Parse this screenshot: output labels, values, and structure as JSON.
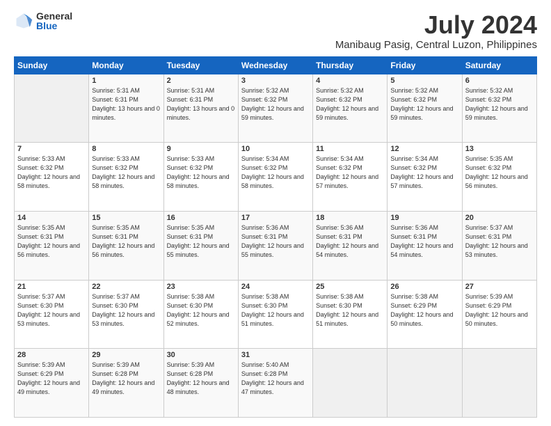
{
  "logo": {
    "general": "General",
    "blue": "Blue"
  },
  "title": "July 2024",
  "subtitle": "Manibaug Pasig, Central Luzon, Philippines",
  "days_header": [
    "Sunday",
    "Monday",
    "Tuesday",
    "Wednesday",
    "Thursday",
    "Friday",
    "Saturday"
  ],
  "weeks": [
    [
      {
        "day": "",
        "sunrise": "",
        "sunset": "",
        "daylight": ""
      },
      {
        "day": "1",
        "sunrise": "Sunrise: 5:31 AM",
        "sunset": "Sunset: 6:31 PM",
        "daylight": "Daylight: 13 hours and 0 minutes."
      },
      {
        "day": "2",
        "sunrise": "Sunrise: 5:31 AM",
        "sunset": "Sunset: 6:31 PM",
        "daylight": "Daylight: 13 hours and 0 minutes."
      },
      {
        "day": "3",
        "sunrise": "Sunrise: 5:32 AM",
        "sunset": "Sunset: 6:32 PM",
        "daylight": "Daylight: 12 hours and 59 minutes."
      },
      {
        "day": "4",
        "sunrise": "Sunrise: 5:32 AM",
        "sunset": "Sunset: 6:32 PM",
        "daylight": "Daylight: 12 hours and 59 minutes."
      },
      {
        "day": "5",
        "sunrise": "Sunrise: 5:32 AM",
        "sunset": "Sunset: 6:32 PM",
        "daylight": "Daylight: 12 hours and 59 minutes."
      },
      {
        "day": "6",
        "sunrise": "Sunrise: 5:32 AM",
        "sunset": "Sunset: 6:32 PM",
        "daylight": "Daylight: 12 hours and 59 minutes."
      }
    ],
    [
      {
        "day": "7",
        "sunrise": "Sunrise: 5:33 AM",
        "sunset": "Sunset: 6:32 PM",
        "daylight": "Daylight: 12 hours and 58 minutes."
      },
      {
        "day": "8",
        "sunrise": "Sunrise: 5:33 AM",
        "sunset": "Sunset: 6:32 PM",
        "daylight": "Daylight: 12 hours and 58 minutes."
      },
      {
        "day": "9",
        "sunrise": "Sunrise: 5:33 AM",
        "sunset": "Sunset: 6:32 PM",
        "daylight": "Daylight: 12 hours and 58 minutes."
      },
      {
        "day": "10",
        "sunrise": "Sunrise: 5:34 AM",
        "sunset": "Sunset: 6:32 PM",
        "daylight": "Daylight: 12 hours and 58 minutes."
      },
      {
        "day": "11",
        "sunrise": "Sunrise: 5:34 AM",
        "sunset": "Sunset: 6:32 PM",
        "daylight": "Daylight: 12 hours and 57 minutes."
      },
      {
        "day": "12",
        "sunrise": "Sunrise: 5:34 AM",
        "sunset": "Sunset: 6:32 PM",
        "daylight": "Daylight: 12 hours and 57 minutes."
      },
      {
        "day": "13",
        "sunrise": "Sunrise: 5:35 AM",
        "sunset": "Sunset: 6:32 PM",
        "daylight": "Daylight: 12 hours and 56 minutes."
      }
    ],
    [
      {
        "day": "14",
        "sunrise": "Sunrise: 5:35 AM",
        "sunset": "Sunset: 6:31 PM",
        "daylight": "Daylight: 12 hours and 56 minutes."
      },
      {
        "day": "15",
        "sunrise": "Sunrise: 5:35 AM",
        "sunset": "Sunset: 6:31 PM",
        "daylight": "Daylight: 12 hours and 56 minutes."
      },
      {
        "day": "16",
        "sunrise": "Sunrise: 5:35 AM",
        "sunset": "Sunset: 6:31 PM",
        "daylight": "Daylight: 12 hours and 55 minutes."
      },
      {
        "day": "17",
        "sunrise": "Sunrise: 5:36 AM",
        "sunset": "Sunset: 6:31 PM",
        "daylight": "Daylight: 12 hours and 55 minutes."
      },
      {
        "day": "18",
        "sunrise": "Sunrise: 5:36 AM",
        "sunset": "Sunset: 6:31 PM",
        "daylight": "Daylight: 12 hours and 54 minutes."
      },
      {
        "day": "19",
        "sunrise": "Sunrise: 5:36 AM",
        "sunset": "Sunset: 6:31 PM",
        "daylight": "Daylight: 12 hours and 54 minutes."
      },
      {
        "day": "20",
        "sunrise": "Sunrise: 5:37 AM",
        "sunset": "Sunset: 6:31 PM",
        "daylight": "Daylight: 12 hours and 53 minutes."
      }
    ],
    [
      {
        "day": "21",
        "sunrise": "Sunrise: 5:37 AM",
        "sunset": "Sunset: 6:30 PM",
        "daylight": "Daylight: 12 hours and 53 minutes."
      },
      {
        "day": "22",
        "sunrise": "Sunrise: 5:37 AM",
        "sunset": "Sunset: 6:30 PM",
        "daylight": "Daylight: 12 hours and 53 minutes."
      },
      {
        "day": "23",
        "sunrise": "Sunrise: 5:38 AM",
        "sunset": "Sunset: 6:30 PM",
        "daylight": "Daylight: 12 hours and 52 minutes."
      },
      {
        "day": "24",
        "sunrise": "Sunrise: 5:38 AM",
        "sunset": "Sunset: 6:30 PM",
        "daylight": "Daylight: 12 hours and 51 minutes."
      },
      {
        "day": "25",
        "sunrise": "Sunrise: 5:38 AM",
        "sunset": "Sunset: 6:30 PM",
        "daylight": "Daylight: 12 hours and 51 minutes."
      },
      {
        "day": "26",
        "sunrise": "Sunrise: 5:38 AM",
        "sunset": "Sunset: 6:29 PM",
        "daylight": "Daylight: 12 hours and 50 minutes."
      },
      {
        "day": "27",
        "sunrise": "Sunrise: 5:39 AM",
        "sunset": "Sunset: 6:29 PM",
        "daylight": "Daylight: 12 hours and 50 minutes."
      }
    ],
    [
      {
        "day": "28",
        "sunrise": "Sunrise: 5:39 AM",
        "sunset": "Sunset: 6:29 PM",
        "daylight": "Daylight: 12 hours and 49 minutes."
      },
      {
        "day": "29",
        "sunrise": "Sunrise: 5:39 AM",
        "sunset": "Sunset: 6:28 PM",
        "daylight": "Daylight: 12 hours and 49 minutes."
      },
      {
        "day": "30",
        "sunrise": "Sunrise: 5:39 AM",
        "sunset": "Sunset: 6:28 PM",
        "daylight": "Daylight: 12 hours and 48 minutes."
      },
      {
        "day": "31",
        "sunrise": "Sunrise: 5:40 AM",
        "sunset": "Sunset: 6:28 PM",
        "daylight": "Daylight: 12 hours and 47 minutes."
      },
      {
        "day": "",
        "sunrise": "",
        "sunset": "",
        "daylight": ""
      },
      {
        "day": "",
        "sunrise": "",
        "sunset": "",
        "daylight": ""
      },
      {
        "day": "",
        "sunrise": "",
        "sunset": "",
        "daylight": ""
      }
    ]
  ]
}
